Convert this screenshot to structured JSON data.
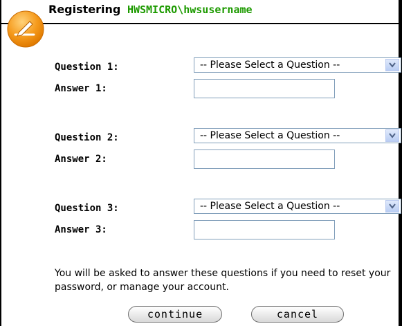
{
  "header": {
    "title": "Registering",
    "account": "HWSMICRO\\hwsusername"
  },
  "questions": [
    {
      "question_label": "Question 1:",
      "answer_label": "Answer 1:",
      "select_value": "-- Please Select a Question --",
      "answer_value": ""
    },
    {
      "question_label": "Question 2:",
      "answer_label": "Answer 2:",
      "select_value": "-- Please Select a Question --",
      "answer_value": ""
    },
    {
      "question_label": "Question 3:",
      "answer_label": "Answer 3:",
      "select_value": "-- Please Select a Question --",
      "answer_value": ""
    }
  ],
  "notice": "You will be asked to answer these questions if you need to reset your password, or manage your account.",
  "buttons": {
    "continue": "continue",
    "cancel": "cancel"
  },
  "colors": {
    "account": "#1d9a00",
    "logo": "#f5a623"
  },
  "icons": {
    "logo": "pencil-writing-icon",
    "dropdown": "chevron-down-icon"
  }
}
